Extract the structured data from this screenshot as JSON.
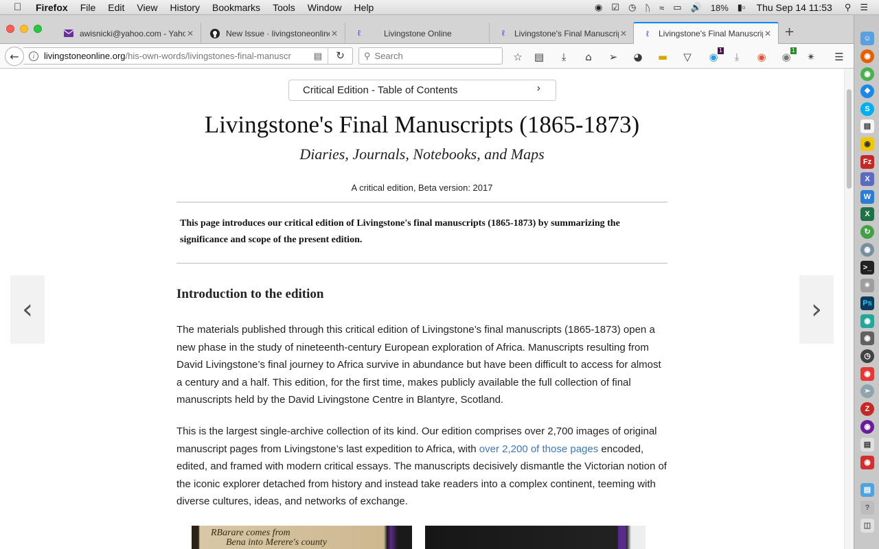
{
  "menubar": {
    "app": "Firefox",
    "items": [
      "File",
      "Edit",
      "View",
      "History",
      "Bookmarks",
      "Tools",
      "Window",
      "Help"
    ],
    "battery": "18%",
    "clock": "Thu Sep 14  11:53"
  },
  "tabs": [
    {
      "title": "awisnicki@yahoo.com - Yaho",
      "icon": "mail-icon"
    },
    {
      "title": "New Issue · livingstoneonline/",
      "icon": "github-icon"
    },
    {
      "title": "Livingstone Online",
      "icon": "livingstone-icon"
    },
    {
      "title": "Livingstone's Final Manuscrip",
      "icon": "livingstone-icon"
    },
    {
      "title": "Livingstone's Final Manuscrip",
      "icon": "livingstone-icon",
      "active": true
    }
  ],
  "navbar": {
    "url_domain": "livingstoneonline.org",
    "url_path": "/his-own-words/livingstones-final-manuscr",
    "search_placeholder": "Search",
    "badges": {
      "slack": "1",
      "extension": "1"
    }
  },
  "page": {
    "toc_button": "Critical Edition - Table of Contents",
    "title": "Livingstone's Final Manuscripts (1865-1873)",
    "subtitle": "Diaries, Journals, Notebooks, and Maps",
    "version": "A critical edition, Beta version: 2017",
    "summary": "This page introduces our critical edition of Livingstone's final manuscripts (1865-1873) by summarizing the significance and scope of the present edition.",
    "section_heading": "Introduction to the edition",
    "para1": "The materials published through this critical edition of Livingstone’s final manuscripts (1865-1873) open a new phase in the study of nineteenth-century European exploration of Africa. Manuscripts resulting from David Livingstone’s final journey to Africa survive in abundance but have been difficult to access for almost a century and a half. This edition, for the first time, makes publicly available the full collection of final manuscripts held by the David Livingstone Centre in Blantyre, Scotland.",
    "para2_before": "This is the largest single-archive collection of its kind. Our edition comprises over 2,700 images of original manuscript pages from Livingstone’s last expedition to Africa, with ",
    "para2_link": "over 2,200 of those pages",
    "para2_after": " encoded, edited, and framed with modern critical essays. The manuscripts decisively dismantle the Victorian notion of the iconic explorer detached from history and instead take readers into a complex continent, teeming with diverse cultures, ideas, and networks of exchange.",
    "manuscript_text_1": "RBarare comes from",
    "manuscript_text_2": "Bena into Merere's county"
  },
  "colors": {
    "accent": "#0a84ff",
    "link": "#3b78b7"
  }
}
